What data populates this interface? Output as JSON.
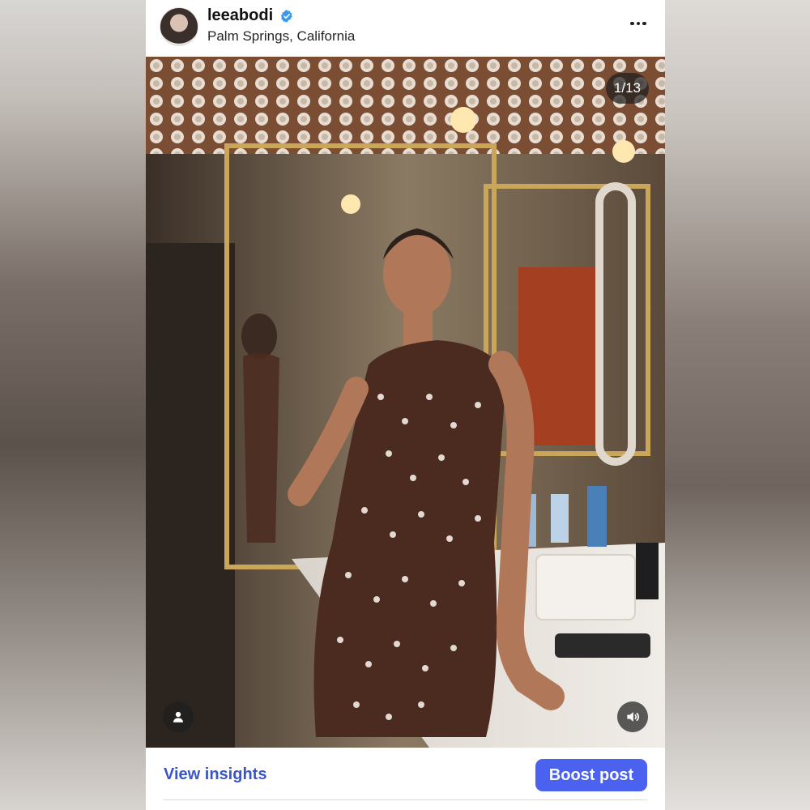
{
  "post": {
    "username": "leeabodi",
    "verified": true,
    "location": "Palm Springs, California",
    "more_icon": "more-horizontal-icon"
  },
  "media": {
    "counter": "1/13",
    "description_icons": {
      "tags": "user-icon",
      "audio": "speaker-icon"
    }
  },
  "actions": {
    "insights_label": "View insights",
    "boost_label": "Boost post"
  },
  "colors": {
    "accent": "#4b62f0",
    "link": "#3a55c8",
    "verified_badge": "#3897f0"
  }
}
